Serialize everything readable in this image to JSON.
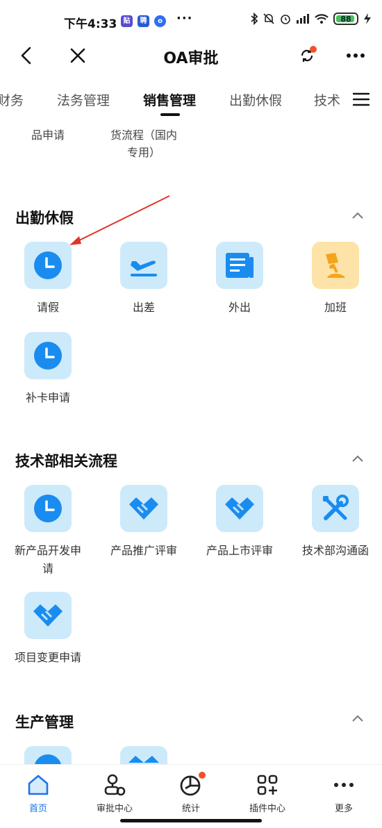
{
  "status_bar": {
    "time": "下午4:33",
    "app_icons": [
      "贴",
      "聘",
      "o"
    ],
    "more": "···",
    "battery": "88"
  },
  "header": {
    "title": "OA审批"
  },
  "tabs": {
    "items": [
      "财务",
      "法务管理",
      "销售管理",
      "出勤休假",
      "技术"
    ],
    "active": "销售管理"
  },
  "partial_items": {
    "left_label": "品申请",
    "right_label_line1": "货流程（国内",
    "right_label_line2": "专用）"
  },
  "sections": [
    {
      "title": "出勤休假",
      "items": [
        {
          "label": "请假",
          "icon": "clock-icon"
        },
        {
          "label": "出差",
          "icon": "airplane-icon"
        },
        {
          "label": "外出",
          "icon": "newspaper-icon"
        },
        {
          "label": "加班",
          "icon": "desk-lamp-icon"
        },
        {
          "label": "补卡申请",
          "icon": "clock-icon"
        }
      ]
    },
    {
      "title": "技术部相关流程",
      "items": [
        {
          "label": "新产品开发申请",
          "label_line1": "新产品开发申",
          "label_line2": "请",
          "icon": "clock-icon"
        },
        {
          "label": "产品推广评审",
          "icon": "handshake-icon"
        },
        {
          "label": "产品上市评审",
          "icon": "handshake-icon"
        },
        {
          "label": "技术部沟通函",
          "icon": "tools-icon"
        },
        {
          "label": "项目变更申请",
          "icon": "handshake-icon"
        }
      ]
    },
    {
      "title": "生产管理",
      "items": []
    }
  ],
  "bottom_nav": [
    {
      "label": "首页",
      "icon": "home-icon"
    },
    {
      "label": "审批中心",
      "icon": "approval-icon"
    },
    {
      "label": "统计",
      "icon": "pie-chart-icon"
    },
    {
      "label": "插件中心",
      "icon": "plugin-icon"
    },
    {
      "label": "更多",
      "icon": "more-icon"
    }
  ],
  "colors": {
    "accent": "#1a74e8",
    "icon_blue": "#1a8cf0",
    "tile_blue": "#cdeafb",
    "tile_orange": "#fde3a8",
    "badge": "#f5502a",
    "annotation_arrow": "#e0342a"
  }
}
